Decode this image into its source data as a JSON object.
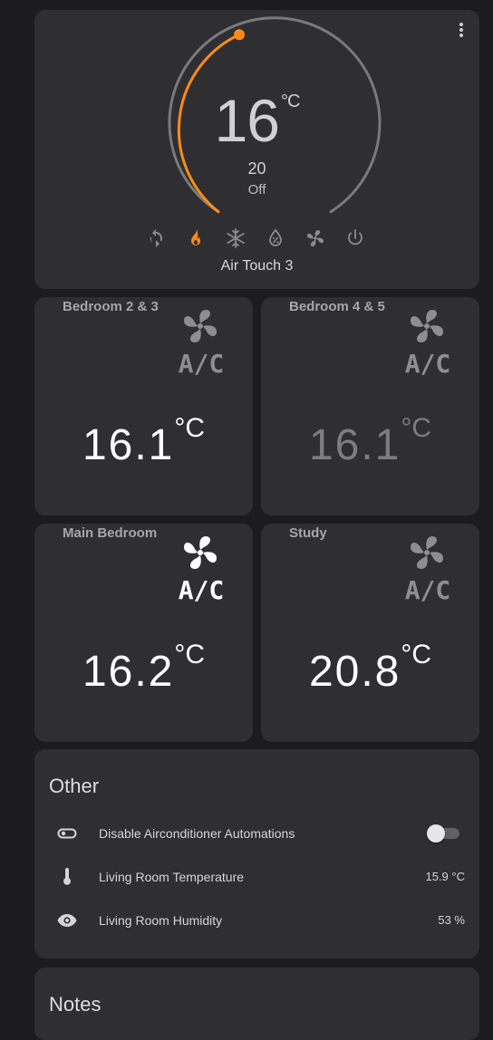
{
  "thermostat": {
    "current_temp": "16",
    "unit": "°C",
    "target_temp": "20",
    "state": "Off",
    "name": "Air Touch 3",
    "accent_color": "#ff8a1a",
    "modes": [
      {
        "icon": "refresh-icon",
        "active": false
      },
      {
        "icon": "flame-icon",
        "active": true
      },
      {
        "icon": "snowflake-icon",
        "active": false
      },
      {
        "icon": "water-percent-icon",
        "active": false
      },
      {
        "icon": "fan-icon",
        "active": false
      },
      {
        "icon": "power-icon",
        "active": false
      }
    ]
  },
  "rooms": [
    {
      "name": "Bedroom 2 & 3",
      "temp": "16.1",
      "unit": "°C",
      "active": true
    },
    {
      "name": "Bedroom 4 & 5",
      "temp": "16.1",
      "unit": "°C",
      "active": false
    },
    {
      "name": "Main Bedroom",
      "temp": "16.2",
      "unit": "°C",
      "active": true
    },
    {
      "name": "Study",
      "temp": "20.8",
      "unit": "°C",
      "active": true
    }
  ],
  "ac_label": "A/C",
  "other": {
    "title": "Other",
    "rows": [
      {
        "icon": "toggle-switch-icon",
        "label": "Disable Airconditioner Automations",
        "toggle_on": false
      },
      {
        "icon": "thermometer-icon",
        "label": "Living Room Temperature",
        "value": "15.9 °C"
      },
      {
        "icon": "eye-icon",
        "label": "Living Room Humidity",
        "value": "53 %"
      }
    ]
  },
  "notes": {
    "title": "Notes"
  }
}
